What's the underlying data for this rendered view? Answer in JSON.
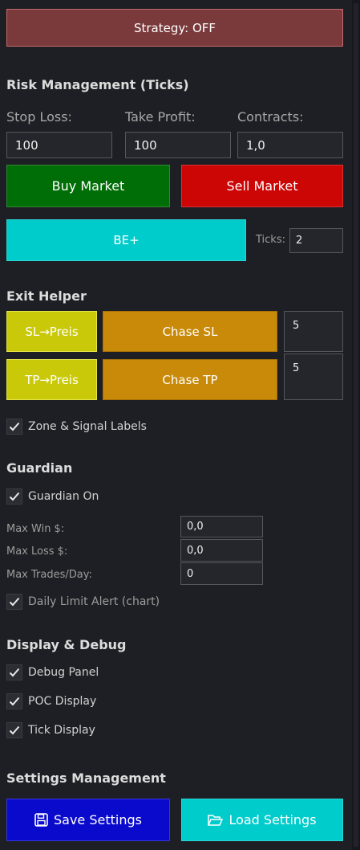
{
  "strategy_button": "Strategy: OFF",
  "risk": {
    "heading": "Risk Management (Ticks)",
    "stop_loss_label": "Stop Loss:",
    "take_profit_label": "Take Profit:",
    "contracts_label": "Contracts:",
    "stop_loss_value": "100",
    "take_profit_value": "100",
    "contracts_value": "1,0",
    "buy_label": "Buy Market",
    "sell_label": "Sell Market",
    "be_label": "BE+",
    "ticks_label": "Ticks:",
    "ticks_value": "2"
  },
  "exit": {
    "heading": "Exit Helper",
    "sl_price": "SL→Preis",
    "tp_price": "TP→Preis",
    "chase_sl": "Chase SL",
    "chase_tp": "Chase TP",
    "chase_sl_value": "5",
    "chase_tp_value": "5",
    "zone_labels": "Zone & Signal Labels"
  },
  "guardian": {
    "heading": "Guardian",
    "on_label": "Guardian On",
    "max_win_label": "Max Win $:",
    "max_loss_label": "Max Loss $:",
    "max_trades_label": "Max Trades/Day:",
    "max_win_value": "0,0",
    "max_loss_value": "0,0",
    "max_trades_value": "0",
    "daily_alert": "Daily Limit Alert (chart)"
  },
  "display": {
    "heading": "Display & Debug",
    "debug_panel": "Debug Panel",
    "poc_display": "POC Display",
    "tick_display": "Tick Display"
  },
  "settings": {
    "heading": "Settings Management",
    "save_label": "Save Settings",
    "load_label": "Load Settings"
  },
  "colors": {
    "strategy_off": "#7a3a3c",
    "buy": "#006e06",
    "sell": "#cc0505",
    "be": "#00cccc",
    "price_buttons": "#c9c90a",
    "chase_buttons": "#c88a08",
    "save": "#0a0acc",
    "load": "#00cccc"
  },
  "icons": {
    "check": "check-icon",
    "save": "floppy-disk-icon",
    "load": "folder-open-icon"
  }
}
